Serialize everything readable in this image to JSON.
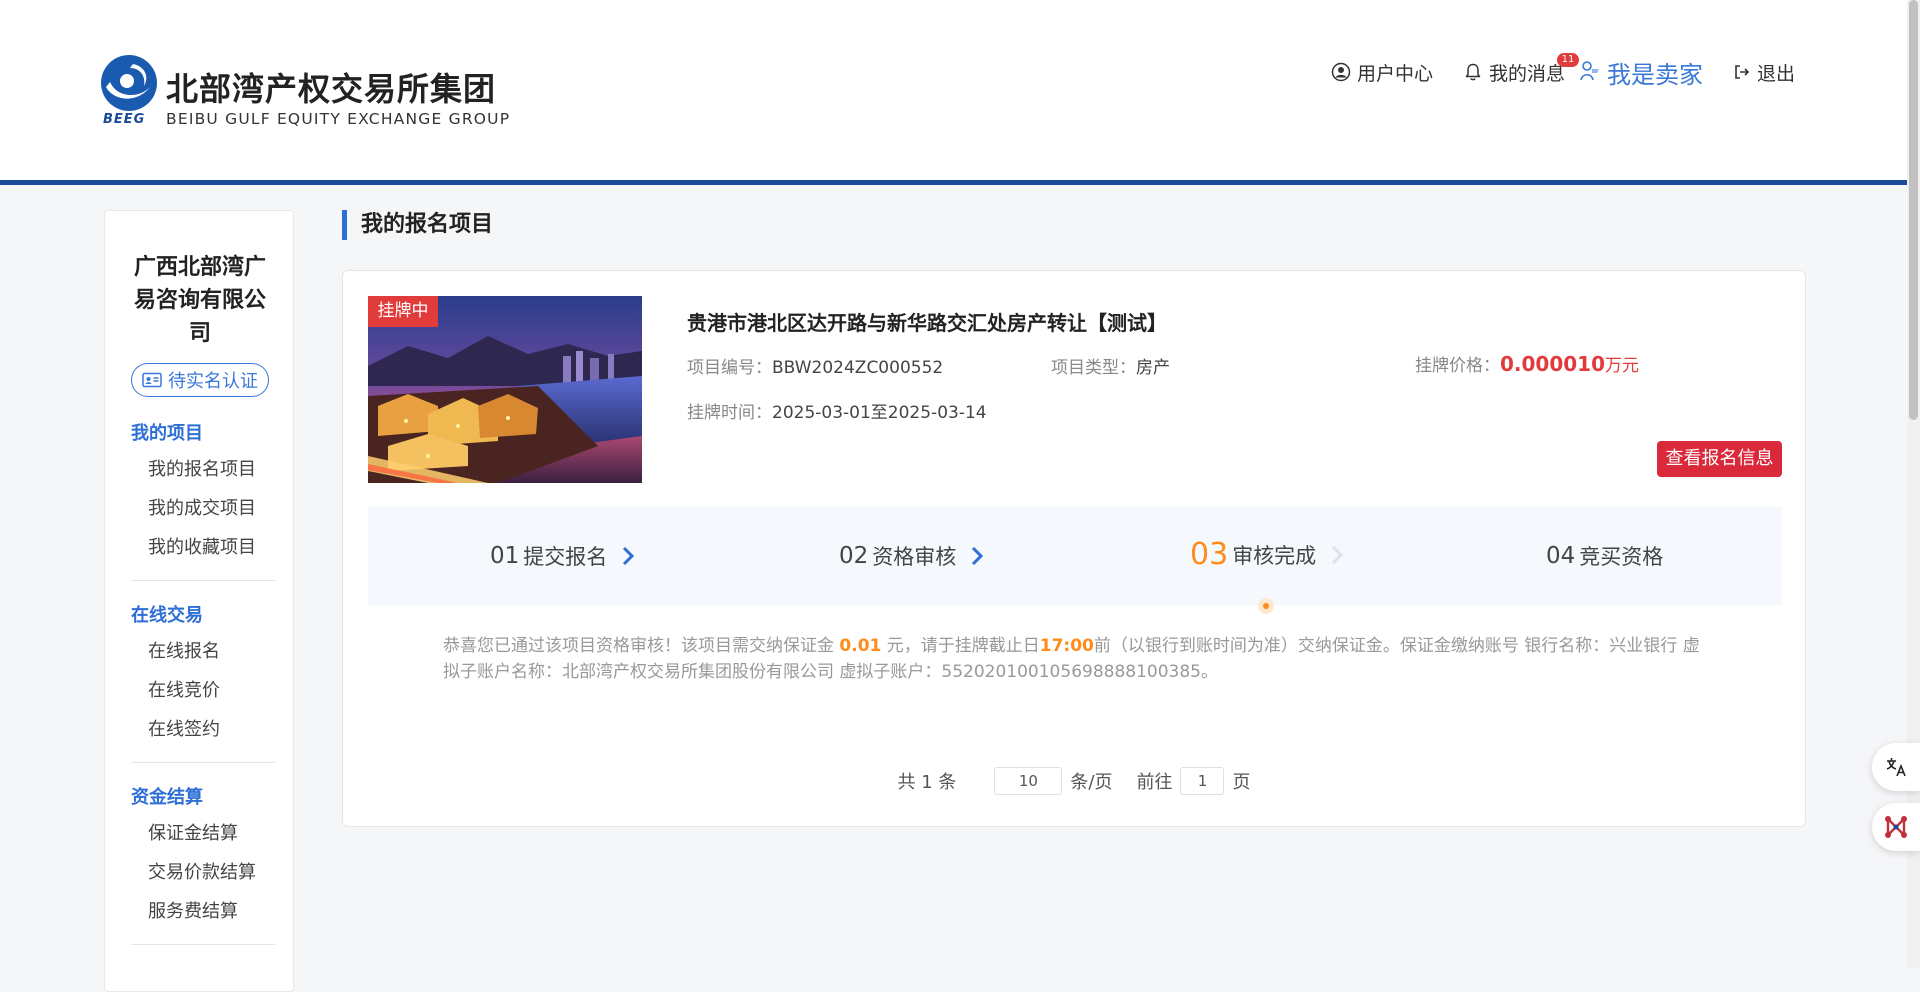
{
  "header": {
    "logo": {
      "name_cn": "北部湾产权交易所集团",
      "name_en": "BEIBU GULF EQUITY EXCHANGE GROUP",
      "abbr": "BEEG"
    },
    "nav": {
      "user_center": "用户中心",
      "messages": "我的消息",
      "messages_badge": "11",
      "seller": "我是卖家",
      "logout": "退出"
    }
  },
  "sidebar": {
    "company_name": "广西北部湾广易咨询有限公司",
    "cert_label": "待实名认证",
    "sections": [
      {
        "title": "我的项目",
        "items": [
          "我的报名项目",
          "我的成交项目",
          "我的收藏项目"
        ]
      },
      {
        "title": "在线交易",
        "items": [
          "在线报名",
          "在线竞价",
          "在线签约"
        ]
      },
      {
        "title": "资金结算",
        "items": [
          "保证金结算",
          "交易价款结算",
          "服务费结算"
        ]
      }
    ]
  },
  "main": {
    "page_title": "我的报名项目",
    "project": {
      "status": "挂牌中",
      "title": "贵港市港北区达开路与新华路交汇处房产转让【测试】",
      "code_label": "项目编号：",
      "code": "BBW2024ZC000552",
      "type_label": "项目类型：",
      "type": "房产",
      "price_label": "挂牌价格：",
      "price": "0.000010",
      "price_unit": "万元",
      "time_label": "挂牌时间：",
      "time": "2025-03-01至2025-03-14",
      "view_button": "查看报名信息"
    },
    "steps": [
      {
        "num": "01",
        "label": "提交报名"
      },
      {
        "num": "02",
        "label": "资格审核"
      },
      {
        "num": "03",
        "label": "审核完成"
      },
      {
        "num": "04",
        "label": "竞买资格"
      }
    ],
    "active_step": 3,
    "notice": {
      "part1": "恭喜您已通过该项目资格审核！该项目需交纳保证金 ",
      "amount": "0.01",
      "part2": " 元，请于挂牌截止日",
      "deadline": "17:00",
      "part3": "前（以银行到账时间为准）交纳保证金。保证金缴纳账号  银行名称：兴业银行 虚拟子账户名称：北部湾产权交易所集团股份有限公司 虚拟子账户：552020100105698888100385。"
    },
    "pager": {
      "total": "共 1 条",
      "page_size": "10",
      "per_page": "条/页",
      "goto": "前往",
      "page": "1",
      "page_unit": "页"
    }
  },
  "colors": {
    "brand_blue": "#1a4a98",
    "link_blue": "#2d6fd6",
    "danger_red": "#d9293b",
    "active_orange": "#ff8c1a"
  }
}
